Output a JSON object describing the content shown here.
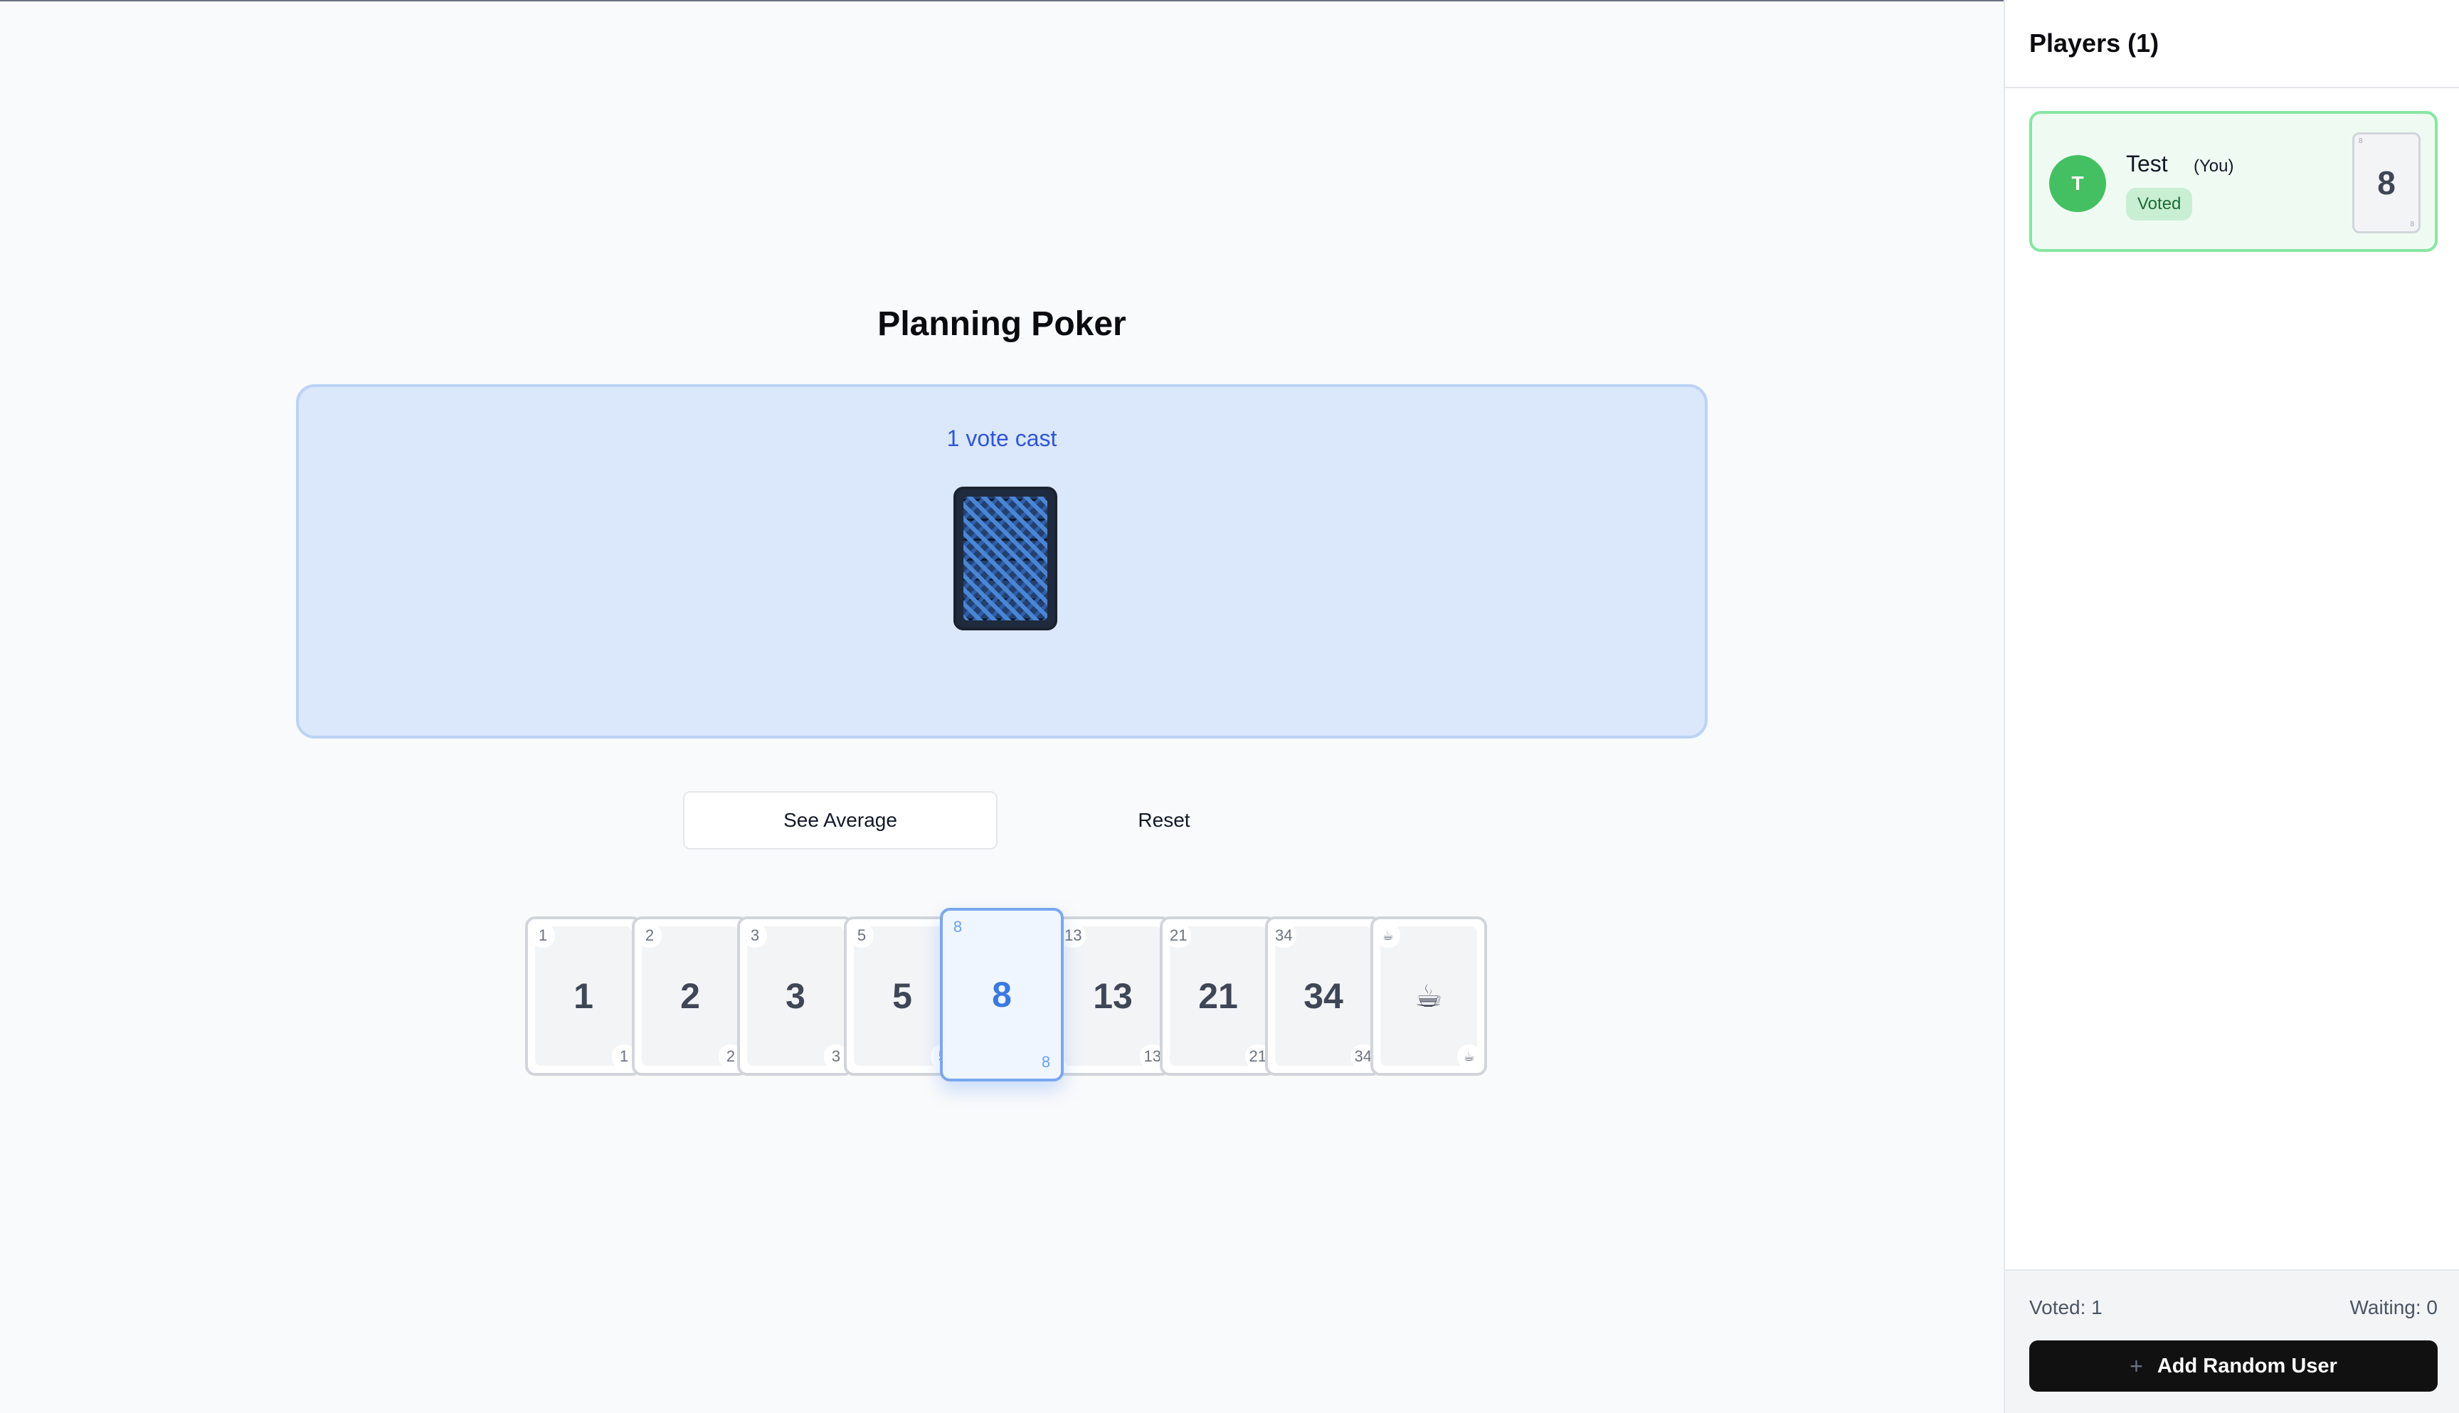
{
  "page": {
    "title": "Planning Poker"
  },
  "table": {
    "vote_status": "1 vote cast"
  },
  "controls": {
    "see_average_label": "See Average",
    "reset_label": "Reset"
  },
  "hand": {
    "selected": "8",
    "cards": [
      {
        "label": "1"
      },
      {
        "label": "2"
      },
      {
        "label": "3"
      },
      {
        "label": "5"
      },
      {
        "label": "8"
      },
      {
        "label": "13"
      },
      {
        "label": "21"
      },
      {
        "label": "34"
      },
      {
        "label": "☕"
      }
    ]
  },
  "sidebar": {
    "title": "Players (1)",
    "players": [
      {
        "initial": "T",
        "name": "Test",
        "tag": "(You)",
        "status": "Voted",
        "card": "8",
        "avatar_color": "#44c062"
      }
    ],
    "footer": {
      "voted": "Voted: 1",
      "waiting": "Waiting: 0",
      "add_button_label": "Add Random User",
      "add_icon": "plus-icon"
    }
  },
  "colors": {
    "accent": "#3b7ae0",
    "panel": "#dbe7fb",
    "voted_green": "#44c062"
  }
}
